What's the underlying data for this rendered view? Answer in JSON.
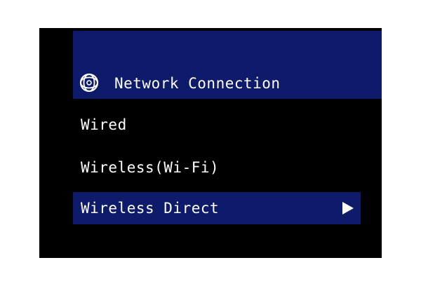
{
  "header": {
    "title": "Network Connection",
    "icon": "network-globe-icon"
  },
  "menu": {
    "items": [
      {
        "label": "Wired",
        "selected": false
      },
      {
        "label": "Wireless(Wi-Fi)",
        "selected": false
      },
      {
        "label": "Wireless Direct",
        "selected": true,
        "icon": "arrow-right-icon"
      }
    ]
  },
  "colors": {
    "background": "#000000",
    "highlight": "#0e1a6a",
    "text": "#ffffff"
  }
}
